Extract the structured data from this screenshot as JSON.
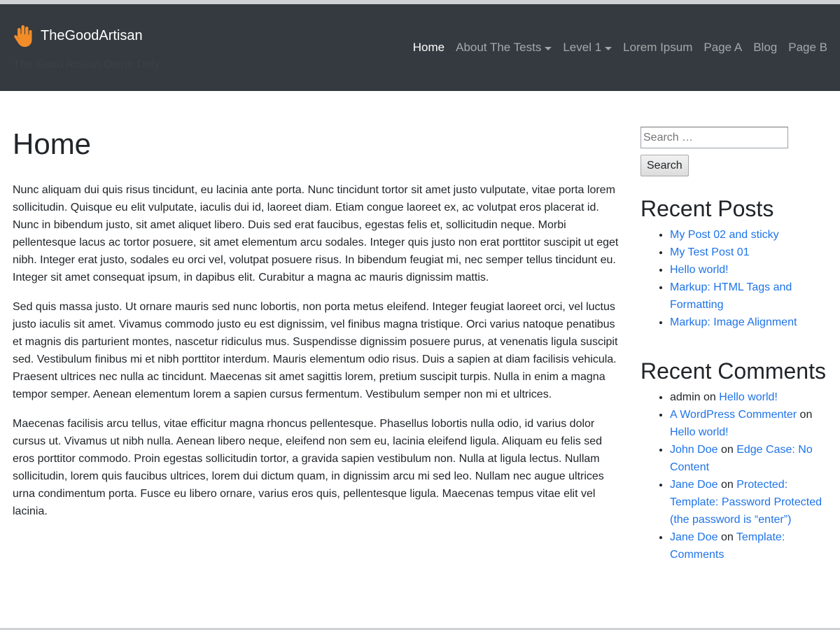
{
  "header": {
    "site_name": "TheGoodArtisan",
    "tagline": "The Good Artisan Demo Only",
    "logo_icon": "hand-icon",
    "colors": {
      "navbar_bg": "#343a40",
      "logo": "#f28c28"
    },
    "nav": [
      {
        "label": "Home",
        "active": true
      },
      {
        "label": "About The Tests",
        "dropdown": true
      },
      {
        "label": "Level 1",
        "dropdown": true
      },
      {
        "label": "Lorem Ipsum"
      },
      {
        "label": "Page A"
      },
      {
        "label": "Blog"
      },
      {
        "label": "Page B"
      }
    ]
  },
  "main": {
    "title": "Home",
    "paragraphs": [
      "Nunc aliquam dui quis risus tincidunt, eu lacinia ante porta. Nunc tincidunt tortor sit amet justo vulputate, vitae porta lorem sollicitudin. Quisque eu elit vulputate, iaculis dui id, laoreet diam. Etiam congue laoreet ex, ac volutpat eros placerat id. Nunc in bibendum justo, sit amet aliquet libero. Duis sed erat faucibus, egestas felis et, sollicitudin neque. Morbi pellentesque lacus ac tortor posuere, sit amet elementum arcu sodales. Integer quis justo non erat porttitor suscipit ut eget nibh. Integer erat justo, sodales eu orci vel, volutpat posuere risus. In bibendum feugiat mi, nec semper tellus tincidunt eu. Integer sit amet consequat ipsum, in dapibus elit. Curabitur a magna ac mauris dignissim mattis.",
      "Sed quis massa justo. Ut ornare mauris sed nunc lobortis, non porta metus eleifend. Integer feugiat laoreet orci, vel luctus justo iaculis sit amet. Vivamus commodo justo eu est dignissim, vel finibus magna tristique. Orci varius natoque penatibus et magnis dis parturient montes, nascetur ridiculus mus. Suspendisse dignissim posuere purus, at venenatis ligula suscipit sed. Vestibulum finibus mi et nibh porttitor interdum. Mauris elementum odio risus. Duis a sapien at diam facilisis vehicula. Praesent ultrices nec nulla ac tincidunt. Maecenas sit amet sagittis lorem, pretium suscipit turpis. Nulla in enim a magna tempor semper. Aenean elementum lorem a sapien cursus fermentum. Vestibulum semper non mi et ultrices.",
      "Maecenas facilisis arcu tellus, vitae efficitur magna rhoncus pellentesque. Phasellus lobortis nulla odio, id varius dolor cursus ut. Vivamus ut nibh nulla. Aenean libero neque, eleifend non sem eu, lacinia eleifend ligula. Aliquam eu felis sed eros porttitor commodo. Proin egestas sollicitudin tortor, a gravida sapien vestibulum non. Nulla at ligula lectus. Nullam sollicitudin, lorem quis faucibus ultrices, lorem dui dictum quam, in dignissim arcu mi sed leo. Nullam nec augue ultrices urna condimentum porta. Fusce eu libero ornare, varius eros quis, pellentesque ligula. Maecenas tempus vitae elit vel lacinia."
    ]
  },
  "sidebar": {
    "search": {
      "placeholder": "Search …",
      "button": "Search"
    },
    "recent_posts": {
      "title": "Recent Posts",
      "items": [
        "My Post 02 and sticky",
        "My Test Post 01",
        "Hello world!",
        "Markup: HTML Tags and Formatting",
        "Markup: Image Alignment"
      ]
    },
    "recent_comments": {
      "title": "Recent Comments",
      "on": "on",
      "items": [
        {
          "author": "admin",
          "author_link": false,
          "post": "Hello world!"
        },
        {
          "author": "A WordPress Commenter",
          "author_link": true,
          "post": "Hello world!"
        },
        {
          "author": "John Doe",
          "author_link": true,
          "post": "Edge Case: No Content"
        },
        {
          "author": "Jane Doe",
          "author_link": true,
          "post": "Protected: Template: Password Protected (the password is “enter”)"
        },
        {
          "author": "Jane Doe",
          "author_link": true,
          "post": "Template: Comments"
        }
      ]
    },
    "link_color": "#1e73e8"
  }
}
